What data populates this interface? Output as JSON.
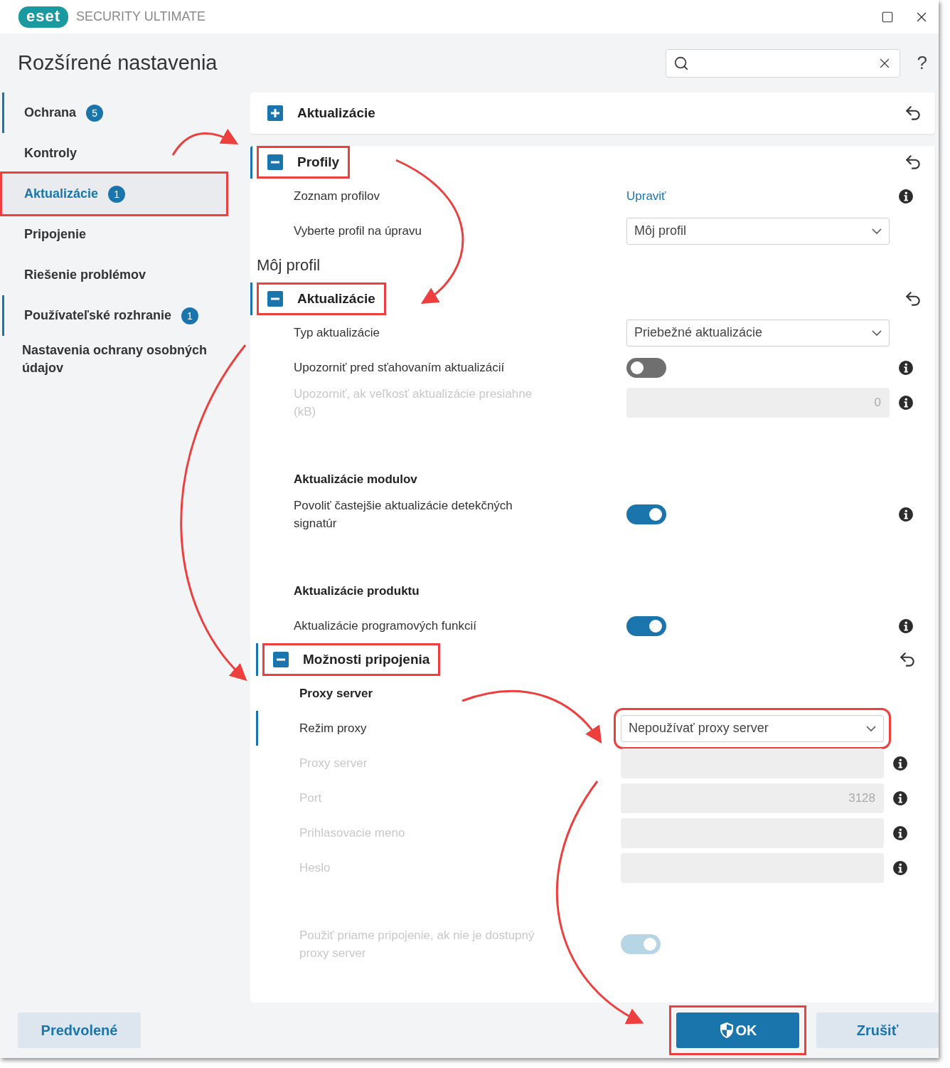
{
  "window": {
    "logo": "eset",
    "product": "SECURITY ULTIMATE",
    "title": "Rozšírené nastavenia",
    "help": "?"
  },
  "sidebar": [
    {
      "label": "Ochrana",
      "badge": "5",
      "selected": false,
      "modified": true,
      "highlighted": false
    },
    {
      "label": "Kontroly",
      "selected": false,
      "modified": false,
      "highlighted": false
    },
    {
      "label": "Aktualizácie",
      "badge": "1",
      "selected": true,
      "modified": false,
      "highlighted": true
    },
    {
      "label": "Pripojenie",
      "selected": false,
      "modified": false,
      "highlighted": false
    },
    {
      "label": "Riešenie problémov",
      "selected": false,
      "modified": false,
      "highlighted": false
    },
    {
      "label": "Používateľské rozhranie",
      "badge": "1",
      "selected": false,
      "modified": true,
      "highlighted": false
    },
    {
      "label": "Nastavenia ochrany osobných údajov",
      "selected": false,
      "modified": false,
      "highlighted": false
    }
  ],
  "cards": [
    {
      "items": [
        {
          "kind": "section",
          "label": "Aktualizácie",
          "expanded": false
        }
      ]
    },
    {
      "items": [
        {
          "kind": "section",
          "label": "Profily",
          "expanded": true,
          "modified": true,
          "highlighted": true,
          "children": [
            {
              "kind": "link",
              "label": "Zoznam profilov",
              "value": "Upraviť",
              "info": true
            },
            {
              "kind": "select",
              "label": "Vyberte profil na úpravu",
              "value": "Môj profil"
            }
          ]
        },
        {
          "kind": "heading",
          "label": "Môj profil"
        },
        {
          "kind": "section",
          "label": "Aktualizácie",
          "expanded": true,
          "modified": true,
          "highlighted": true,
          "children": [
            {
              "kind": "select",
              "label": "Typ aktualizácie",
              "value": "Priebežné aktualizácie"
            },
            {
              "kind": "toggle",
              "label": "Upozorniť pred sťahovaním aktualizácií",
              "on": false,
              "disabled": false,
              "info": true
            },
            {
              "kind": "input",
              "label": "Upozorniť, ak veľkosť aktualizácie presiahne (kB)",
              "value": "0",
              "disabled": true,
              "info": true
            },
            {
              "kind": "subheading",
              "label": "Aktualizácie modulov"
            },
            {
              "kind": "toggle",
              "label": "Povoliť častejšie aktualizácie detekčných signatúr",
              "on": true,
              "disabled": false,
              "info": true
            },
            {
              "kind": "subheading",
              "label": "Aktualizácie produktu"
            },
            {
              "kind": "toggle",
              "label": "Aktualizácie programových funkcií",
              "on": true,
              "disabled": false,
              "info": true
            },
            {
              "kind": "section",
              "label": "Možnosti pripojenia",
              "expanded": true,
              "modified": true,
              "highlighted": true,
              "children": [
                {
                  "kind": "subheading",
                  "label": "Proxy server"
                },
                {
                  "kind": "select",
                  "label": "Režim proxy",
                  "value": "Nepoužívať proxy server",
                  "modified": true,
                  "highlighted": true
                },
                {
                  "kind": "input",
                  "label": "Proxy server",
                  "disabled": true,
                  "info": true
                },
                {
                  "kind": "input",
                  "label": "Port",
                  "value": "3128",
                  "disabled": true,
                  "info": true
                },
                {
                  "kind": "input",
                  "label": "Prihlasovacie meno",
                  "disabled": true,
                  "info": true
                },
                {
                  "kind": "input",
                  "label": "Heslo",
                  "disabled": true,
                  "info": true
                },
                {
                  "kind": "toggle",
                  "label": "Použiť priame pripojenie, ak nie je dostupný proxy server",
                  "on": true,
                  "disabled": true
                }
              ]
            }
          ]
        }
      ]
    }
  ],
  "footer": [
    {
      "kind": "default",
      "label": "Predvolené",
      "highlighted": false
    },
    {
      "kind": "ok",
      "label": "OK",
      "highlighted": true
    },
    {
      "kind": "cancel",
      "label": "Zrušiť",
      "highlighted": false
    }
  ]
}
